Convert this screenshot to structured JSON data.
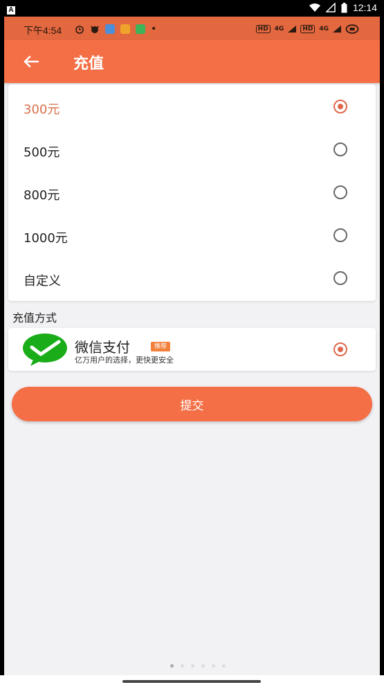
{
  "system_status": {
    "time": "12:14"
  },
  "inner_status": {
    "time": "下午4:54",
    "net1": "4G",
    "net2": "4G"
  },
  "header": {
    "title": "充值"
  },
  "amount_options": [
    {
      "label": "300元",
      "selected": true
    },
    {
      "label": "500元",
      "selected": false
    },
    {
      "label": "800元",
      "selected": false
    },
    {
      "label": "1000元",
      "selected": false
    },
    {
      "label": "自定义",
      "selected": false
    }
  ],
  "payment_section": {
    "title": "充值方式",
    "method": {
      "name": "微信支付",
      "badge": "推荐",
      "description": "亿万用户的选择，更快更安全",
      "selected": true
    }
  },
  "submit": {
    "label": "提交"
  },
  "colors": {
    "accent": "#f46f46",
    "radio_checked": "#e0674a",
    "wechat_green": "#1aad19"
  }
}
